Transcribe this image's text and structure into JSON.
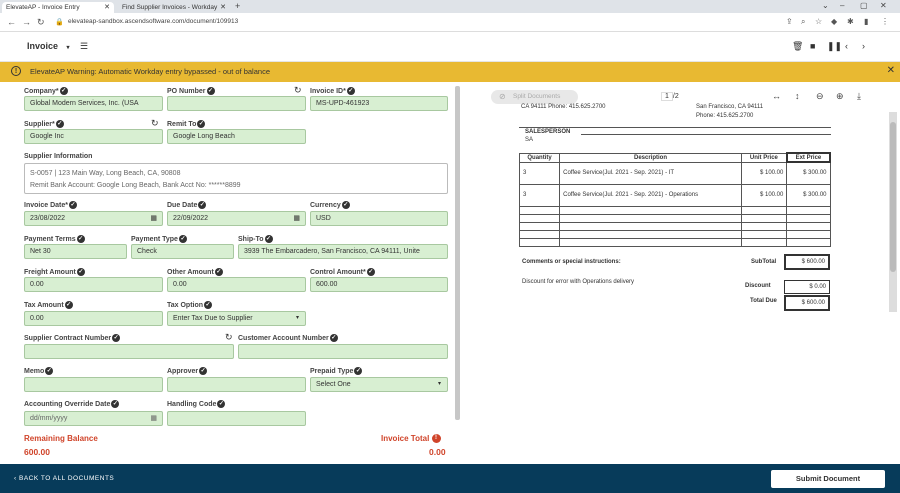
{
  "browser": {
    "tabs": [
      {
        "label": "ElevateAP - Invoice Entry"
      },
      {
        "label": "Find Supplier Invoices - Workday"
      }
    ],
    "url": "elevateap-sandbox.ascendsoftware.com/document/109913"
  },
  "header": {
    "doc_type": "Invoice"
  },
  "warning": {
    "text": "ElevateAP Warning: Automatic Workday entry bypassed - out of balance"
  },
  "form": {
    "company": {
      "label": "Company*",
      "value": "Global Modern Services, Inc. (USA"
    },
    "po_number": {
      "label": "PO Number",
      "value": ""
    },
    "invoice_id": {
      "label": "Invoice ID*",
      "value": "MS-UPD-461923"
    },
    "supplier": {
      "label": "Supplier*",
      "value": "Google Inc"
    },
    "remit_to": {
      "label": "Remit To",
      "value": "Google Long Beach"
    },
    "supplier_info": {
      "label": "Supplier Information",
      "line1": "S-0057 | 123 Main Way, Long Beach, CA, 90808",
      "line2": "Remit Bank Account: Google Long Beach, Bank Acct No: ******8899"
    },
    "invoice_date": {
      "label": "Invoice Date*",
      "value": "23/08/2022"
    },
    "due_date": {
      "label": "Due Date",
      "value": "22/09/2022"
    },
    "currency": {
      "label": "Currency",
      "value": "USD"
    },
    "payment_terms": {
      "label": "Payment Terms",
      "value": "Net 30"
    },
    "payment_type": {
      "label": "Payment Type",
      "value": "Check"
    },
    "ship_to": {
      "label": "Ship-To",
      "value": "3939 The Embarcadero, San Francisco, CA 94111, Unite"
    },
    "freight_amount": {
      "label": "Freight Amount",
      "value": "0.00"
    },
    "other_amount": {
      "label": "Other Amount",
      "value": "0.00"
    },
    "control_amount": {
      "label": "Control Amount*",
      "value": "600.00"
    },
    "tax_amount": {
      "label": "Tax Amount",
      "value": "0.00"
    },
    "tax_option": {
      "label": "Tax Option",
      "value": "Enter Tax Due to Supplier"
    },
    "supplier_contract_number": {
      "label": "Supplier Contract Number",
      "value": ""
    },
    "customer_account_number": {
      "label": "Customer Account Number",
      "value": ""
    },
    "memo": {
      "label": "Memo",
      "value": ""
    },
    "approver": {
      "label": "Approver",
      "value": ""
    },
    "prepaid_type": {
      "label": "Prepaid Type",
      "value": "Select One"
    },
    "accounting_override_date": {
      "label": "Accounting Override Date",
      "placeholder": "dd/mm/yyyy"
    },
    "handling_code": {
      "label": "Handling Code",
      "value": ""
    },
    "remaining_balance": {
      "label": "Remaining Balance",
      "value": "600.00"
    },
    "invoice_total": {
      "label": "Invoice Total",
      "value": "0.00"
    }
  },
  "pdf": {
    "split_label": "Split Documents",
    "page_current": "1",
    "page_total": "/2",
    "top_left": "CA 94111 Phone: 415.625.2700",
    "top_right1": "San Francisco, CA 94111",
    "top_right2": "Phone: 415.625.2700",
    "salesperson_label": "SALESPERSON",
    "salesperson_value": "SA",
    "table_headers": [
      "Quantity",
      "Description",
      "Unit Price",
      "Ext Price"
    ],
    "rows": [
      {
        "qty": "3",
        "desc": "Coffee Service(Jul. 2021 - Sep. 2021) - IT",
        "unit": "$ 100.00",
        "ext": "$ 300.00"
      },
      {
        "qty": "3",
        "desc": "Coffee Service(Jul. 2021 - Sep. 2021) - Operations",
        "unit": "$ 100.00",
        "ext": "$ 300.00"
      }
    ],
    "comments_label": "Comments or special instructions:",
    "comments_text": "Discount for error with Operations delivery",
    "subtotal_label": "SubTotal",
    "subtotal_value": "$ 600.00",
    "discount_label": "Discount",
    "discount_value": "$ 0.00",
    "total_due_label": "Total Due",
    "total_due_value": "$ 600.00"
  },
  "footer": {
    "back_label": "BACK TO ALL DOCUMENTS",
    "submit_label": "Submit Document"
  }
}
